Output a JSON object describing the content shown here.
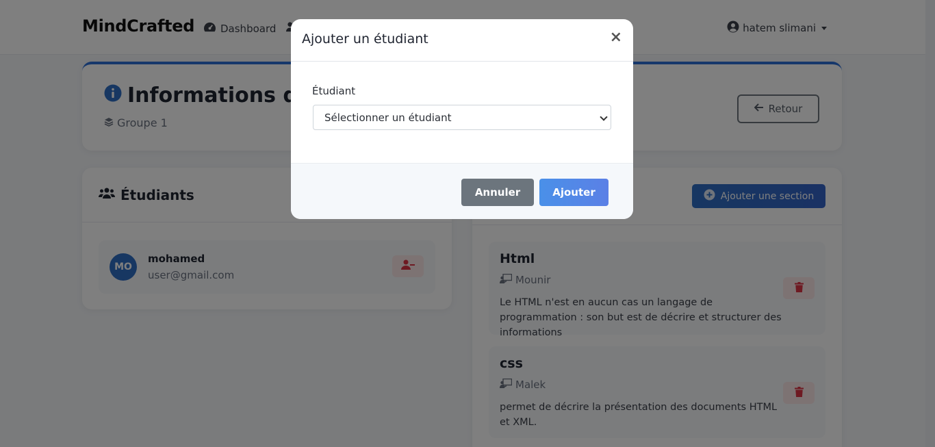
{
  "navbar": {
    "brand": "MindCrafted",
    "links": [
      {
        "label": "Dashboard",
        "icon": "dashboard-icon"
      },
      {
        "label": "",
        "icon": "users-icon"
      }
    ],
    "user": {
      "name": "hatem slimani",
      "icon": "user-circle-icon"
    }
  },
  "info": {
    "title": "Informations du",
    "subtitle": "Groupe 1",
    "back_label": "Retour"
  },
  "students": {
    "heading": "Étudiants",
    "items": [
      {
        "initials": "MO",
        "name": "mohamed",
        "email": "user@gmail.com"
      }
    ]
  },
  "sections": {
    "add_label": "Ajouter une section",
    "items": [
      {
        "title": "Html",
        "teacher": "Mounir",
        "description": "Le HTML n'est en aucun cas un langage de programmation : son but est de décrire et structurer des informations"
      },
      {
        "title": "css",
        "teacher": "Malek",
        "description": "permet de décrire la présentation des documents HTML et XML."
      }
    ]
  },
  "modal": {
    "title": "Ajouter un étudiant",
    "close_glyph": "×",
    "field_label": "Étudiant",
    "select_value": "Sélectionner un étudiant",
    "cancel_label": "Annuler",
    "submit_label": "Ajouter"
  },
  "colors": {
    "primary": "#2f6ec4",
    "danger": "#dc3545",
    "secondary": "#6c757d"
  }
}
